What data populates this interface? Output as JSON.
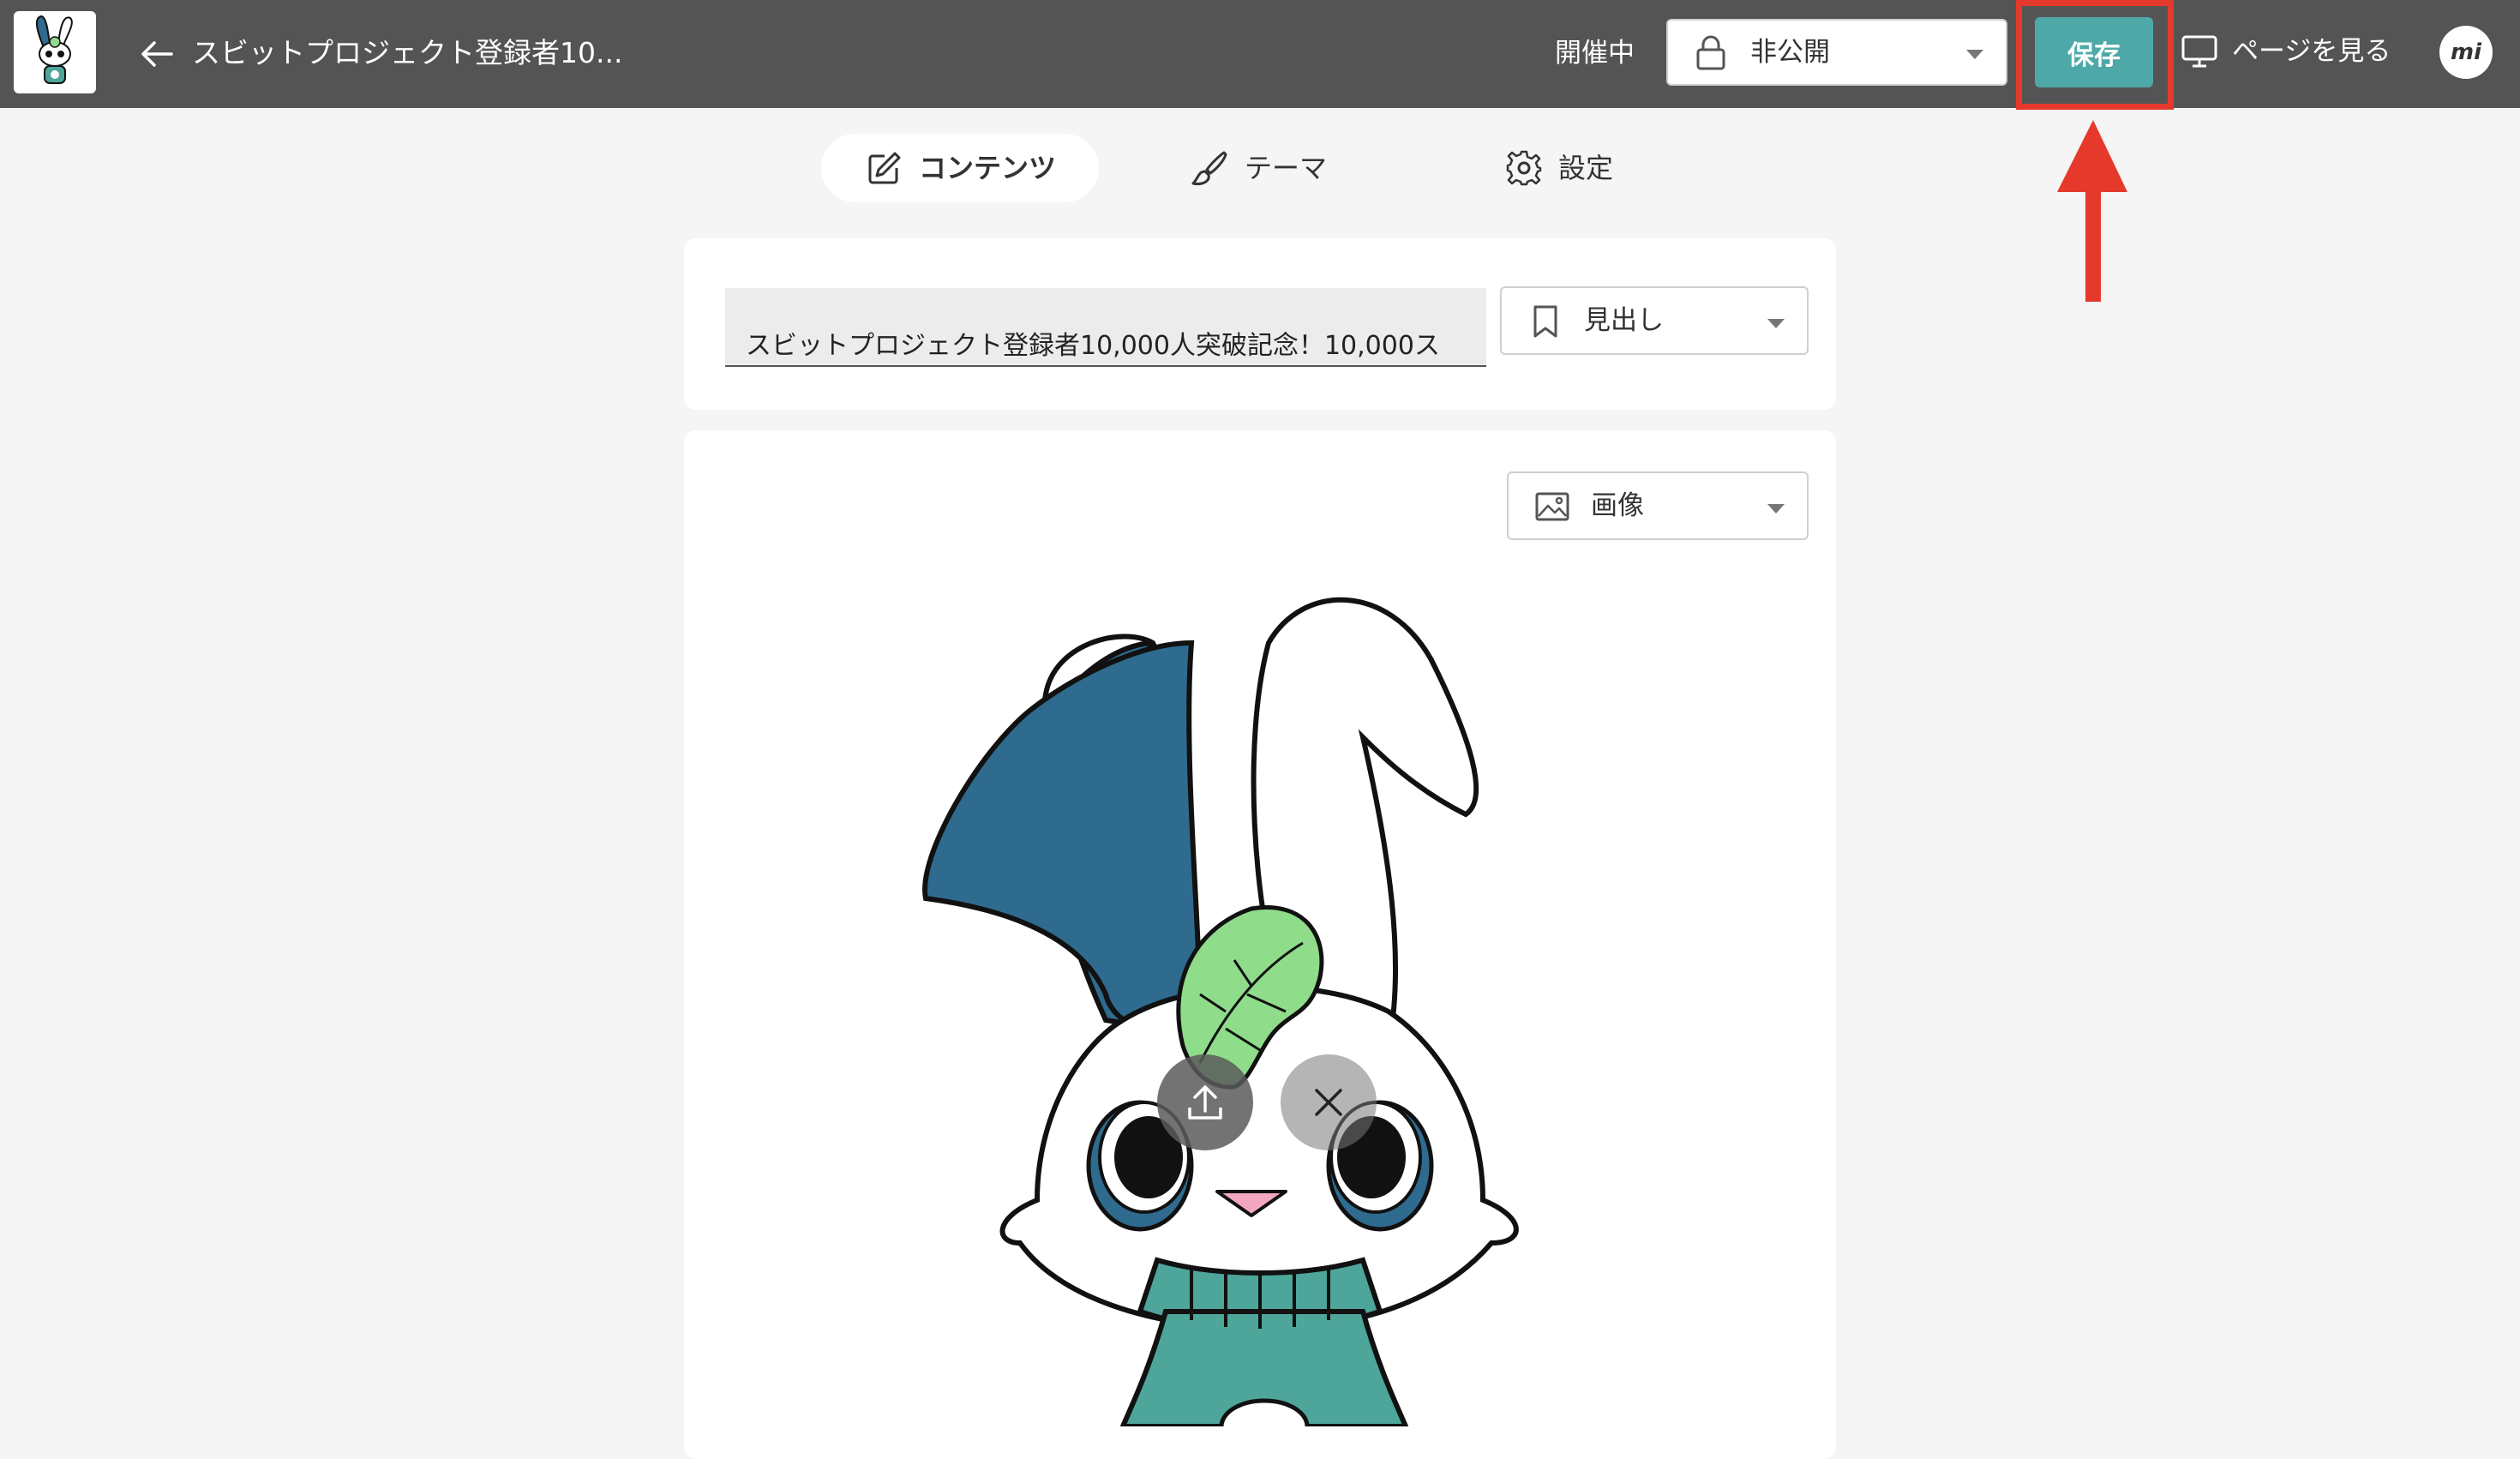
{
  "header": {
    "back_label": "←",
    "title": "スビットプロジェクト登録者10...",
    "event_status": "開催中",
    "visibility": {
      "selected": "非公開",
      "icon": "lock-icon"
    },
    "save_label": "保存",
    "view_page_label": "ページを見る",
    "avatar_text": "mi"
  },
  "tabs": [
    {
      "label": "コンテンツ",
      "icon": "pencil-icon",
      "active": true
    },
    {
      "label": "テーマ",
      "icon": "paintbrush-icon",
      "active": false
    },
    {
      "label": "設定",
      "icon": "gear-icon",
      "active": false
    }
  ],
  "heading_block": {
    "value": "スビットプロジェクト登録者10,000人突破記念！10,000ス",
    "type_label": "見出し",
    "type_icon": "bookmark-icon"
  },
  "image_block": {
    "type_label": "画像",
    "type_icon": "image-icon",
    "upload_icon": "upload-icon",
    "remove_icon": "close-icon"
  },
  "colors": {
    "header_bg": "#545454",
    "accent": "#4fa8a8",
    "highlight": "#e53a2b",
    "mascot_ear": "#2f6b8f",
    "mascot_leaf": "#8fdc8a",
    "mascot_sweater": "#4ea59a"
  }
}
